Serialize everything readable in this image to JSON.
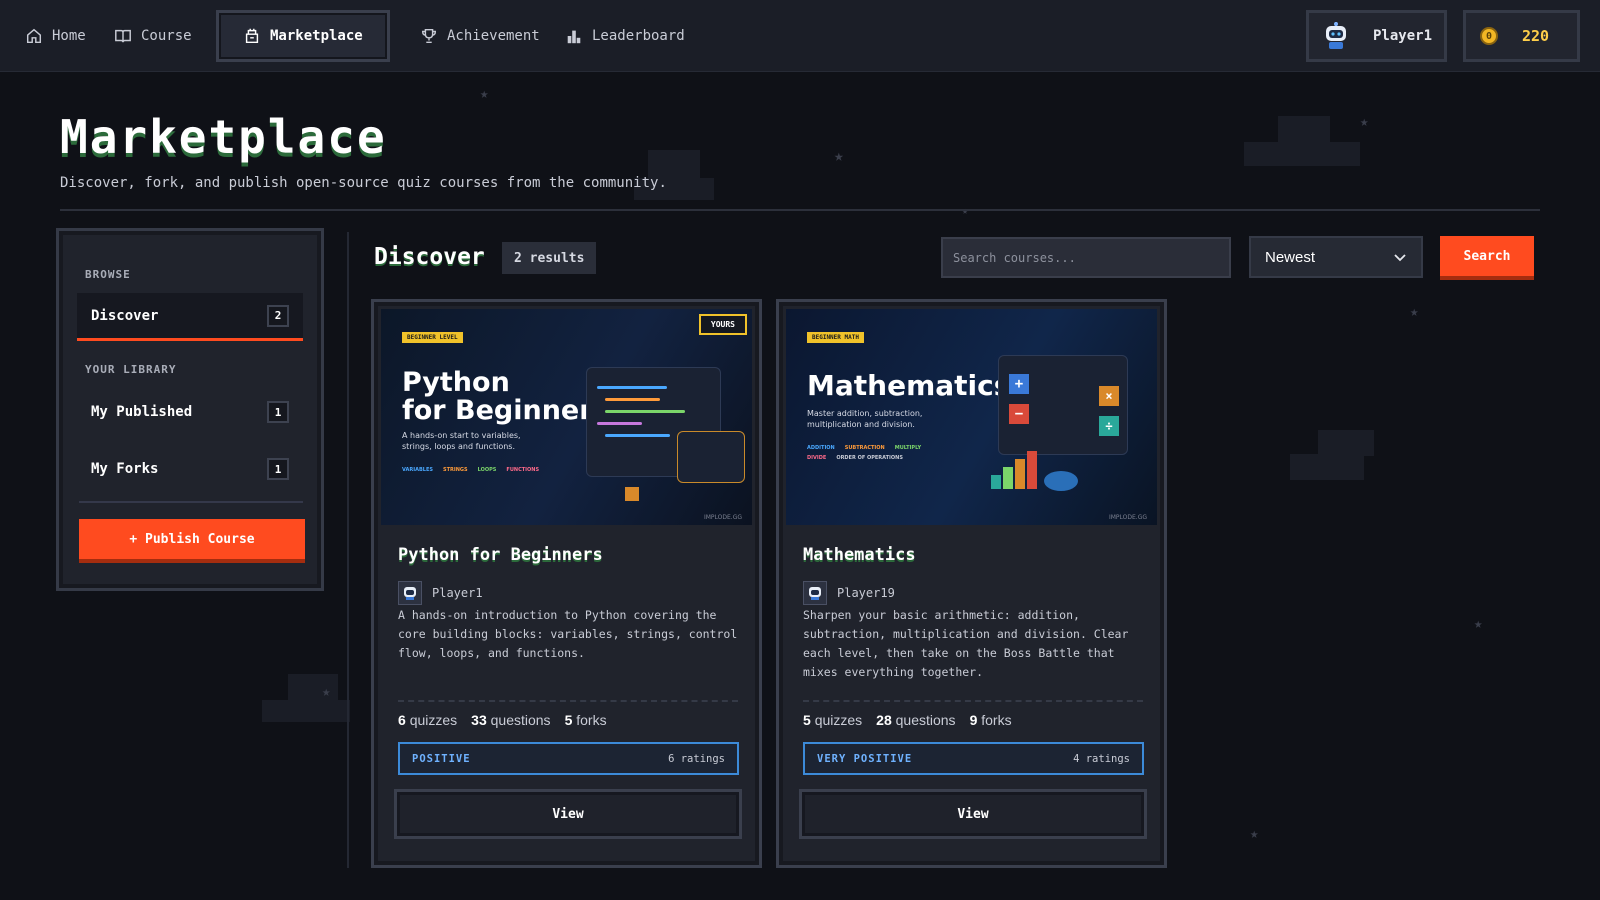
{
  "nav": {
    "home": "Home",
    "course": "Course",
    "marketplace": "Marketplace",
    "achievement": "Achievement",
    "leaderboard": "Leaderboard"
  },
  "user": {
    "name": "Player1",
    "coins": "220"
  },
  "page": {
    "title": "Marketplace",
    "subtitle": "Discover, fork, and publish open-source quiz courses from the community."
  },
  "sidebar": {
    "browse_label": "BROWSE",
    "discover": {
      "label": "Discover",
      "count": "2"
    },
    "library_label": "YOUR LIBRARY",
    "my_published": {
      "label": "My Published",
      "count": "1"
    },
    "my_forks": {
      "label": "My Forks",
      "count": "1"
    },
    "publish_button": "+ Publish Course"
  },
  "discover": {
    "title": "Discover",
    "results": "2 results",
    "search_placeholder": "Search courses...",
    "sort_selected": "Newest",
    "search_button": "Search"
  },
  "cards": [
    {
      "thumb_tag": "BEGINNER LEVEL",
      "thumb_title_1": "Python",
      "thumb_title_2": "for Beginners",
      "thumb_desc_1": "A hands-on start to variables,",
      "thumb_desc_2": "strings, loops and functions.",
      "thumb_tags": [
        "VARIABLES",
        "STRINGS",
        "LOOPS",
        "FUNCTIONS"
      ],
      "watermark": "IMPLODE.GG",
      "badge": "YOURS",
      "title": "Python for Beginners",
      "author": "Player1",
      "description": "A hands-on introduction to Python covering the core building blocks: variables, strings, control flow, loops, and functions.",
      "quizzes": "6",
      "quizzes_label": "quizzes",
      "questions": "33",
      "questions_label": "questions",
      "forks": "5",
      "forks_label": "forks",
      "rating": "POSITIVE",
      "ratings_count": "6 ratings",
      "view": "View"
    },
    {
      "thumb_tag": "BEGINNER MATH",
      "thumb_title_1": "Mathematics",
      "thumb_desc_1": "Master addition, subtraction,",
      "thumb_desc_2": "multiplication and division.",
      "thumb_tags": [
        "ADDITION",
        "SUBTRACTION",
        "MULTIPLY",
        "DIVIDE",
        "ORDER OF OPERATIONS"
      ],
      "watermark": "IMPLODE.GG",
      "title": "Mathematics",
      "author": "Player19",
      "description": "Sharpen your basic arithmetic: addition, subtraction, multiplication and division. Clear each level, then take on the Boss Battle that mixes everything together.",
      "quizzes": "5",
      "quizzes_label": "quizzes",
      "questions": "28",
      "questions_label": "questions",
      "forks": "9",
      "forks_label": "forks",
      "rating": "VERY POSITIVE",
      "ratings_count": "4 ratings",
      "view": "View"
    }
  ],
  "colors": {
    "accent": "#ff4b1f",
    "coin": "#f2b624",
    "rating_border": "#3c8ad8",
    "title_shadow": "#2c6b3b"
  },
  "icons": [
    "home-icon",
    "book-icon",
    "shop-icon",
    "trophy-icon",
    "bar-chart-icon",
    "robot-avatar-icon",
    "coin-icon",
    "chevron-down-icon"
  ]
}
